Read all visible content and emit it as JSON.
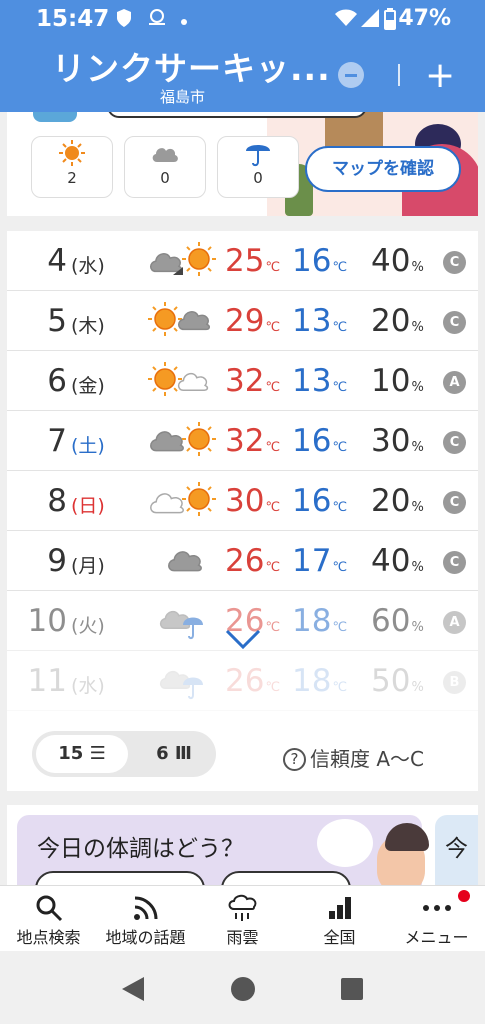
{
  "status_bar": {
    "time": "15:47",
    "battery": "47%"
  },
  "header": {
    "title": "リンクサーキッ...",
    "location": "福島市"
  },
  "summary": {
    "counts": [
      {
        "icon": "sun-icon",
        "value": "2"
      },
      {
        "icon": "cloud-icon",
        "value": "0"
      },
      {
        "icon": "umbrella-icon",
        "value": "0"
      }
    ],
    "map_button": "マップを確認"
  },
  "forecast": {
    "temp_unit": "℃",
    "pop_unit": "%",
    "rows": [
      {
        "day": "4",
        "dow": "(水)",
        "weather": "cloud-then-sun-icon",
        "high": "25",
        "low": "16",
        "pop": "40",
        "reliability": "C"
      },
      {
        "day": "5",
        "dow": "(木)",
        "weather": "sun-cloud-icon",
        "high": "29",
        "low": "13",
        "pop": "20",
        "reliability": "C"
      },
      {
        "day": "6",
        "dow": "(金)",
        "weather": "sun-light-cloud-icon",
        "high": "32",
        "low": "13",
        "pop": "10",
        "reliability": "A"
      },
      {
        "day": "7",
        "dow": "(土)",
        "weather": "cloud-sun-icon",
        "high": "32",
        "low": "16",
        "pop": "30",
        "reliability": "C"
      },
      {
        "day": "8",
        "dow": "(日)",
        "weather": "light-cloud-sun-icon",
        "high": "30",
        "low": "16",
        "pop": "20",
        "reliability": "C"
      },
      {
        "day": "9",
        "dow": "(月)",
        "weather": "cloud-icon",
        "high": "26",
        "low": "17",
        "pop": "40",
        "reliability": "C"
      },
      {
        "day": "10",
        "dow": "(火)",
        "weather": "cloud-rain-icon",
        "high": "26",
        "low": "18",
        "pop": "60",
        "reliability": "A"
      },
      {
        "day": "11",
        "dow": "(水)",
        "weather": "cloud-rain-icon",
        "high": "26",
        "low": "18",
        "pop": "50",
        "reliability": "B"
      }
    ],
    "toggle": {
      "option_15": "15",
      "option_6": "6"
    },
    "reliability_help": "信頼度 A〜C"
  },
  "promo": {
    "question": "今日の体調はどう？",
    "next_peek": "今"
  },
  "bottom_nav": [
    {
      "label": "地点検索",
      "icon": "search-icon"
    },
    {
      "label": "地域の話題",
      "icon": "rss-icon"
    },
    {
      "label": "雨雲",
      "icon": "rain-cloud-icon"
    },
    {
      "label": "全国",
      "icon": "bar-chart-icon"
    },
    {
      "label": "メニュー",
      "icon": "more-icon"
    }
  ],
  "colors": {
    "header": "#4f8fe0",
    "high_temp": "#d9413a",
    "low_temp": "#2a6ec9",
    "saturday": "#2a6ec9",
    "sunday": "#d33"
  }
}
